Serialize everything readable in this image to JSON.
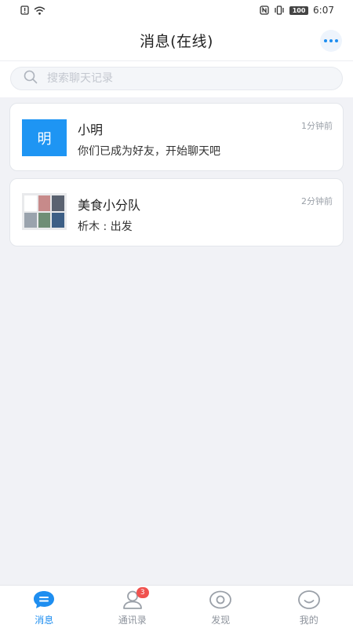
{
  "status_bar": {
    "time": "6:07",
    "battery": "100"
  },
  "header": {
    "title": "消息(在线)"
  },
  "search": {
    "placeholder": "搜索聊天记录"
  },
  "chats": [
    {
      "avatar_text": "明",
      "name": "小明",
      "preview": "你们已成为好友，开始聊天吧",
      "time": "1分钟前"
    },
    {
      "avatar_text": "",
      "name": "美食小分队",
      "preview": "析木 : 出发",
      "time": "2分钟前"
    }
  ],
  "tabs": [
    {
      "label": "消息",
      "icon": "chat-icon",
      "active": true
    },
    {
      "label": "通讯录",
      "icon": "contacts-icon",
      "badge": "3"
    },
    {
      "label": "发现",
      "icon": "eye-icon"
    },
    {
      "label": "我的",
      "icon": "profile-icon"
    }
  ],
  "colors": {
    "accent": "#1e8ef0",
    "badge": "#f0524f",
    "background": "#f1f2f6"
  }
}
